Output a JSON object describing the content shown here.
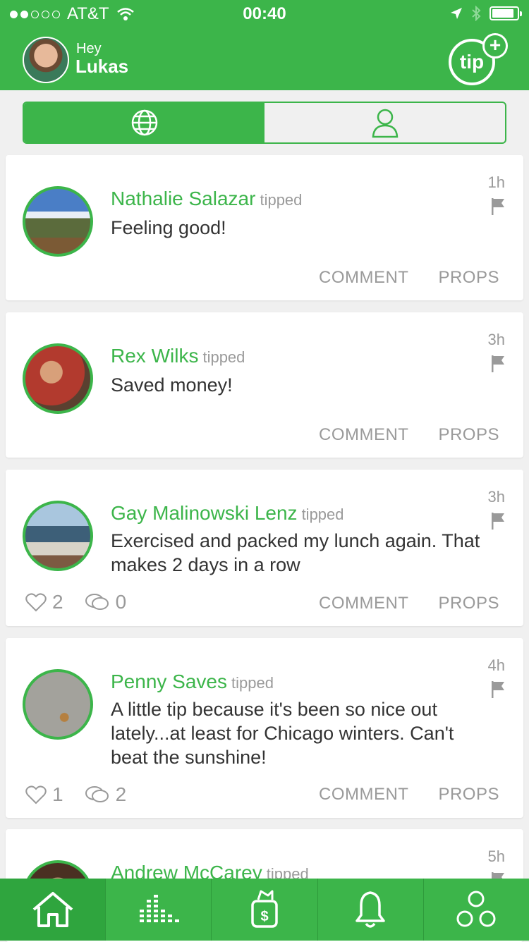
{
  "status": {
    "carrier": "AT&T",
    "time": "00:40"
  },
  "header": {
    "greeting": "Hey",
    "username": "Lukas",
    "tip_label": "tip",
    "tip_plus": "+"
  },
  "segments": [
    "global-icon",
    "user-icon"
  ],
  "feed": [
    {
      "name": "Nathalie Salazar",
      "verb": "tipped",
      "message": "Feeling good!",
      "time": "1h",
      "comment_label": "COMMENT",
      "props_label": "PROPS"
    },
    {
      "name": "Rex Wilks",
      "verb": "tipped",
      "message": "Saved money!",
      "time": "3h",
      "comment_label": "COMMENT",
      "props_label": "PROPS"
    },
    {
      "name": "Gay Malinowski Lenz",
      "verb": "tipped",
      "message": "Exercised and packed my lunch again. That makes 2 days in a row",
      "time": "3h",
      "likes": "2",
      "comments": "0",
      "comment_label": "COMMENT",
      "props_label": "PROPS"
    },
    {
      "name": "Penny Saves",
      "verb": "tipped",
      "message": "A little tip because it's been so nice out lately...at least for Chicago winters. Can't beat the sunshine!",
      "time": "4h",
      "likes": "1",
      "comments": "2",
      "comment_label": "COMMENT",
      "props_label": "PROPS"
    },
    {
      "name": "Andrew McCarey",
      "verb": "tipped",
      "time": "5h"
    }
  ],
  "tabbar": [
    "home-icon",
    "stats-icon",
    "jar-icon",
    "bell-icon",
    "circles-icon"
  ],
  "colors": {
    "brand_green": "#3cb54a",
    "text_gray": "#9a9a9a"
  }
}
